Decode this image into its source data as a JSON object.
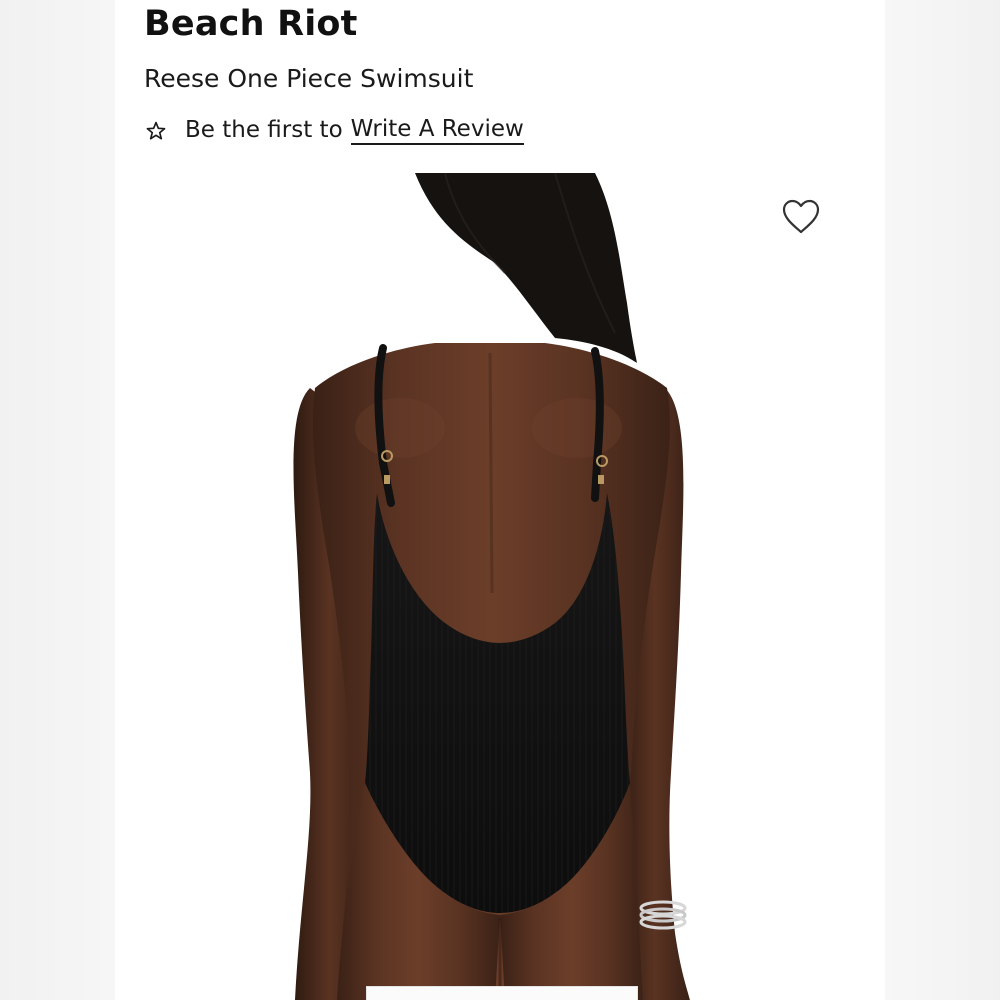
{
  "product": {
    "brand": "Beach Riot",
    "name": "Reese One Piece Swimsuit"
  },
  "reviews": {
    "lead_text": "Be the first to",
    "link_text": "Write A Review",
    "icon": "star-outline-icon"
  },
  "favorite": {
    "icon": "heart-outline-icon"
  },
  "image": {
    "subject": "product-photo"
  },
  "colors": {
    "text": "#1a1a1a",
    "background": "#ffffff",
    "swimsuit": "#141414"
  }
}
